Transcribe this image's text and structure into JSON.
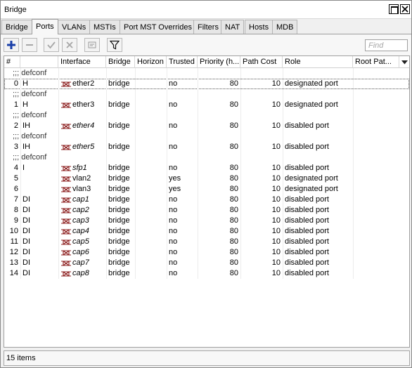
{
  "window": {
    "title": "Bridge"
  },
  "tabs": [
    {
      "label": "Bridge"
    },
    {
      "label": "Ports"
    },
    {
      "label": "VLANs"
    },
    {
      "label": "MSTIs"
    },
    {
      "label": "Port MST Overrides"
    },
    {
      "label": "Filters"
    },
    {
      "label": "NAT"
    },
    {
      "label": "Hosts"
    },
    {
      "label": "MDB"
    }
  ],
  "active_tab": "Ports",
  "search": {
    "placeholder": "Find"
  },
  "columns": [
    "#",
    "",
    "Interface",
    "Bridge",
    "Horizon",
    "Trusted",
    "Priority (h...",
    "Path Cost",
    "Role",
    "Root Pat..."
  ],
  "comments": {
    "c0": ";;; defconf",
    "c1": ";;; defconf",
    "c2": ";;; defconf",
    "c3": ";;; defconf",
    "c4": ";;; defconf"
  },
  "rows": [
    {
      "num": "0",
      "flags": "H",
      "iface": "ether2",
      "bridge": "bridge",
      "horizon": "",
      "trusted": "no",
      "priority": "80",
      "path_cost": "10",
      "role": "designated port",
      "root_path": ""
    },
    {
      "num": "1",
      "flags": "H",
      "iface": "ether3",
      "bridge": "bridge",
      "horizon": "",
      "trusted": "no",
      "priority": "80",
      "path_cost": "10",
      "role": "designated port",
      "root_path": ""
    },
    {
      "num": "2",
      "flags": "IH",
      "iface": "ether4",
      "bridge": "bridge",
      "horizon": "",
      "trusted": "no",
      "priority": "80",
      "path_cost": "10",
      "role": "disabled port",
      "root_path": ""
    },
    {
      "num": "3",
      "flags": "IH",
      "iface": "ether5",
      "bridge": "bridge",
      "horizon": "",
      "trusted": "no",
      "priority": "80",
      "path_cost": "10",
      "role": "disabled port",
      "root_path": ""
    },
    {
      "num": "4",
      "flags": "I",
      "iface": "sfp1",
      "bridge": "bridge",
      "horizon": "",
      "trusted": "no",
      "priority": "80",
      "path_cost": "10",
      "role": "disabled port",
      "root_path": ""
    },
    {
      "num": "5",
      "flags": "",
      "iface": "vlan2",
      "bridge": "bridge",
      "horizon": "",
      "trusted": "yes",
      "priority": "80",
      "path_cost": "10",
      "role": "designated port",
      "root_path": ""
    },
    {
      "num": "6",
      "flags": "",
      "iface": "vlan3",
      "bridge": "bridge",
      "horizon": "",
      "trusted": "yes",
      "priority": "80",
      "path_cost": "10",
      "role": "designated port",
      "root_path": ""
    },
    {
      "num": "7",
      "flags": "DI",
      "iface": "cap1",
      "bridge": "bridge",
      "horizon": "",
      "trusted": "no",
      "priority": "80",
      "path_cost": "10",
      "role": "disabled port",
      "root_path": ""
    },
    {
      "num": "8",
      "flags": "DI",
      "iface": "cap2",
      "bridge": "bridge",
      "horizon": "",
      "trusted": "no",
      "priority": "80",
      "path_cost": "10",
      "role": "disabled port",
      "root_path": ""
    },
    {
      "num": "9",
      "flags": "DI",
      "iface": "cap3",
      "bridge": "bridge",
      "horizon": "",
      "trusted": "no",
      "priority": "80",
      "path_cost": "10",
      "role": "disabled port",
      "root_path": ""
    },
    {
      "num": "10",
      "flags": "DI",
      "iface": "cap4",
      "bridge": "bridge",
      "horizon": "",
      "trusted": "no",
      "priority": "80",
      "path_cost": "10",
      "role": "disabled port",
      "root_path": ""
    },
    {
      "num": "11",
      "flags": "DI",
      "iface": "cap5",
      "bridge": "bridge",
      "horizon": "",
      "trusted": "no",
      "priority": "80",
      "path_cost": "10",
      "role": "disabled port",
      "root_path": ""
    },
    {
      "num": "12",
      "flags": "DI",
      "iface": "cap6",
      "bridge": "bridge",
      "horizon": "",
      "trusted": "no",
      "priority": "80",
      "path_cost": "10",
      "role": "disabled port",
      "root_path": ""
    },
    {
      "num": "13",
      "flags": "DI",
      "iface": "cap7",
      "bridge": "bridge",
      "horizon": "",
      "trusted": "no",
      "priority": "80",
      "path_cost": "10",
      "role": "disabled port",
      "root_path": ""
    },
    {
      "num": "14",
      "flags": "DI",
      "iface": "cap8",
      "bridge": "bridge",
      "horizon": "",
      "trusted": "no",
      "priority": "80",
      "path_cost": "10",
      "role": "disabled port",
      "root_path": ""
    }
  ],
  "status": {
    "items": "15 items"
  },
  "icons": {
    "add": "plus-icon",
    "remove": "minus-icon",
    "enable": "check-icon",
    "disable": "x-icon",
    "comment": "note-icon",
    "filter": "filter-icon",
    "interface": "bridge-port-icon",
    "window_max": "maximize-icon",
    "window_close": "close-icon",
    "columns": "chevron-down-icon"
  },
  "colors": {
    "add_icon": "#1a3fa8",
    "disabled_icon": "#a7a7a7"
  }
}
